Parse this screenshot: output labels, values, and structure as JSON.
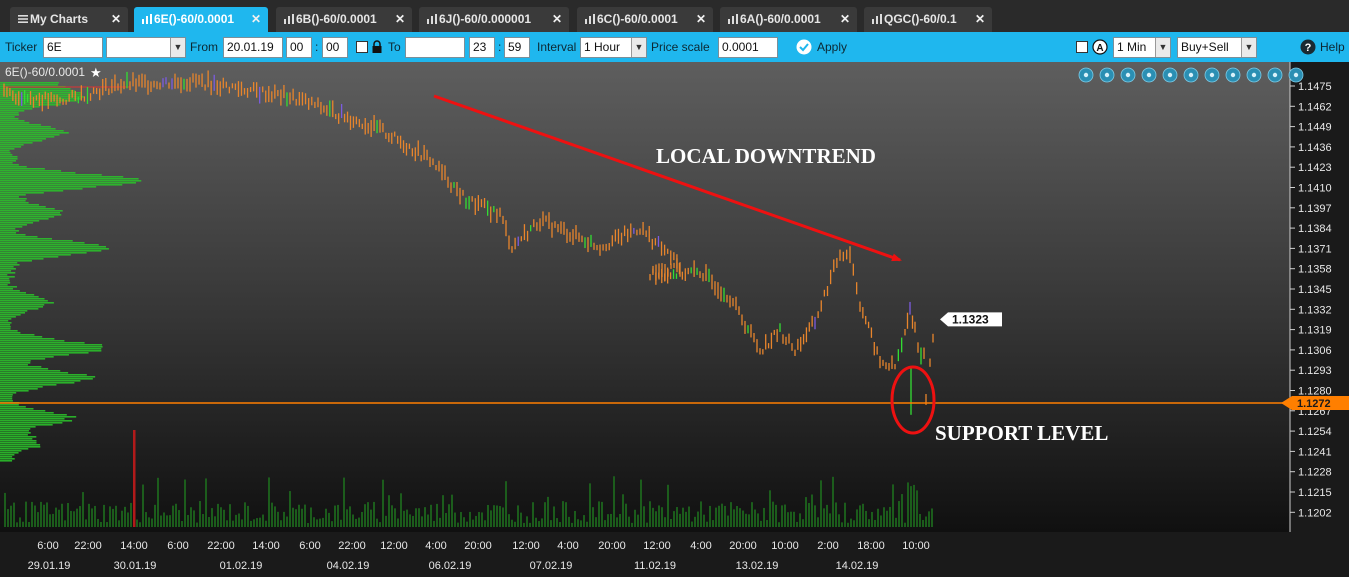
{
  "tabs": [
    {
      "label": "My Charts",
      "icon": "menu-icon",
      "active": false
    },
    {
      "label": "6E()-60/0.0001",
      "icon": "chart-bars-icon",
      "active": true
    },
    {
      "label": "6B()-60/0.0001",
      "icon": "chart-bars-icon",
      "active": false
    },
    {
      "label": "6J()-60/0.000001",
      "icon": "chart-bars-icon",
      "active": false
    },
    {
      "label": "6C()-60/0.0001",
      "icon": "chart-bars-icon",
      "active": false
    },
    {
      "label": "6A()-60/0.0001",
      "icon": "chart-bars-icon",
      "active": false
    },
    {
      "label": "QGC()-60/0.1",
      "icon": "chart-bars-icon",
      "active": false
    }
  ],
  "toolbar": {
    "ticker_label": "Ticker",
    "ticker_value": "6E",
    "ticker_dropdown_value": "",
    "from_label": "From",
    "from_date": "20.01.19",
    "from_hour": "00",
    "from_minute": "00",
    "time_sep": ":",
    "to_label": "To",
    "to_date": "",
    "to_hour": "23",
    "to_minute": "59",
    "interval_label": "Interval",
    "interval_value": "1 Hour",
    "price_scale_label": "Price scale",
    "price_scale_value": "0.0001",
    "apply_label": "Apply",
    "timeframe_value": "1 Min",
    "side_value": "Buy+Sell",
    "help_label": "Help"
  },
  "chart": {
    "title": "6E()-60/0.0001",
    "title_icon": "star-icon",
    "toolbar_icons": [
      "move-icon",
      "zoom-in-icon",
      "zoom-out-icon",
      "grid-icon",
      "columns-icon",
      "pencil-icon",
      "refresh-icon",
      "settings-icon",
      "fullscreen-icon",
      "close-icon",
      "chevron-down-icon"
    ],
    "annotations": {
      "downtrend": "LOCAL DOWNTREND",
      "support": "SUPPORT LEVEL"
    },
    "last_price_label": "1.1323",
    "support_price_label": "1.1272",
    "colors": {
      "bar_main": "#e8852c",
      "bar_up": "#33dd33",
      "bar_down": "#7c5ce0",
      "profile": "#2bbf2b",
      "volume": "#1d6a1d",
      "support_line": "#ff7f00",
      "trend_arrow": "#ee1111",
      "circle": "#ee1111"
    }
  },
  "chart_data": {
    "type": "bar",
    "y_ticks": [
      "1.1475",
      "1.1462",
      "1.1449",
      "1.1436",
      "1.1423",
      "1.1410",
      "1.1397",
      "1.1384",
      "1.1371",
      "1.1358",
      "1.1345",
      "1.1332",
      "1.1319",
      "1.1306",
      "1.1293",
      "1.1280",
      "1.1267",
      "1.1254",
      "1.1241",
      "1.1228",
      "1.1215",
      "1.1202"
    ],
    "ylim": [
      1.1196,
      1.148
    ],
    "x_ticks_time": [
      "6:00",
      "22:00",
      "14:00",
      "6:00",
      "22:00",
      "14:00",
      "6:00",
      "22:00",
      "12:00",
      "4:00",
      "20:00",
      "12:00",
      "4:00",
      "20:00",
      "12:00",
      "4:00",
      "20:00",
      "10:00",
      "2:00",
      "18:00",
      "10:00"
    ],
    "x_ticks_date": [
      "29.01.19",
      "30.01.19",
      "01.02.19",
      "04.02.19",
      "06.02.19",
      "07.02.19",
      "11.02.19",
      "13.02.19",
      "14.02.19"
    ],
    "price_path": [
      [
        0,
        1.147
      ],
      [
        0.1,
        1.1465
      ],
      [
        0.2,
        1.1476
      ],
      [
        0.3,
        1.1478
      ],
      [
        0.4,
        1.1468
      ],
      [
        0.5,
        1.1462
      ],
      [
        0.62,
        1.1447
      ],
      [
        0.76,
        1.1428
      ],
      [
        0.9,
        1.1402
      ],
      [
        1.0,
        1.1393
      ],
      [
        1.1,
        1.1372
      ],
      [
        1.2,
        1.1389
      ],
      [
        1.4,
        1.1372
      ],
      [
        1.5,
        1.1384
      ],
      [
        1.6,
        1.136
      ],
      [
        1.8,
        1.1354
      ],
      [
        2.0,
        1.1356
      ],
      [
        2.15,
        1.134
      ],
      [
        2.3,
        1.1306
      ],
      [
        2.5,
        1.1318
      ],
      [
        2.6,
        1.1306
      ],
      [
        2.75,
        1.1324
      ],
      [
        2.85,
        1.1368
      ],
      [
        3.0,
        1.1368
      ],
      [
        3.15,
        1.1336
      ],
      [
        3.3,
        1.1298
      ],
      [
        3.45,
        1.1295
      ],
      [
        3.55,
        1.1316
      ],
      [
        3.65,
        1.1332
      ],
      [
        3.8,
        1.132
      ],
      [
        3.95,
        1.1308
      ],
      [
        4.0,
        1.1302
      ],
      [
        4.05,
        1.1276
      ],
      [
        4.15,
        1.1297
      ],
      [
        4.22,
        1.133
      ],
      [
        4.26,
        1.1323
      ]
    ],
    "last_price": 1.1323,
    "support_level": 1.1272,
    "low_price": 1.1267
  }
}
